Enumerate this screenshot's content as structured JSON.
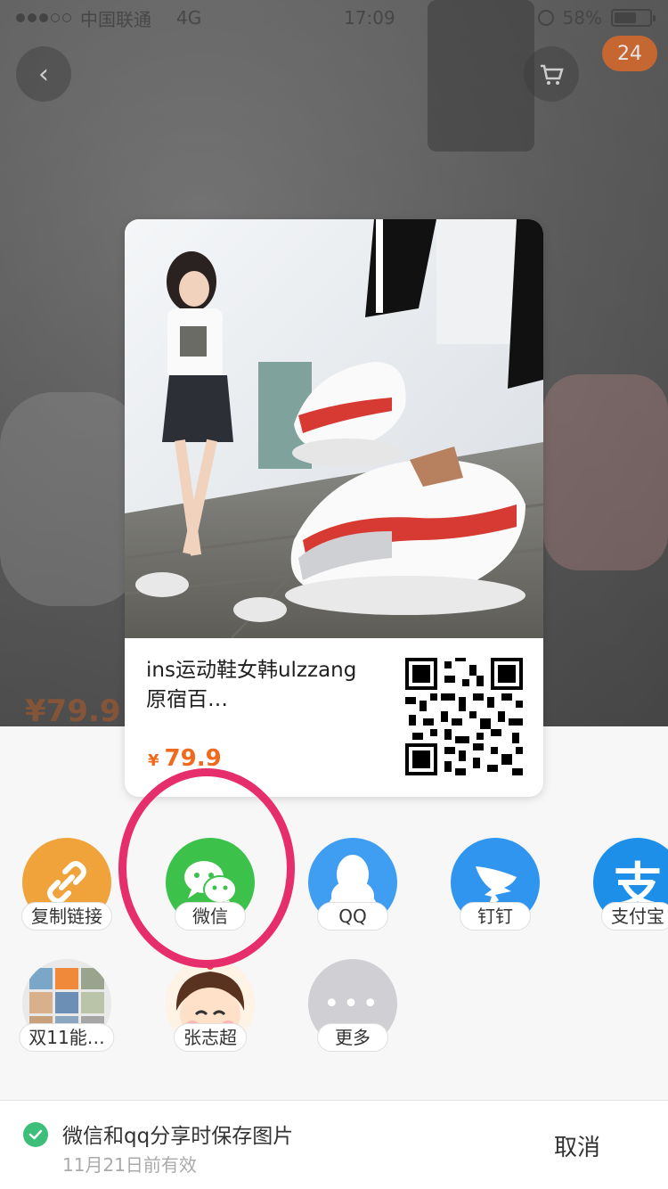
{
  "status_bar": {
    "carrier": "中国联通",
    "network": "4G",
    "time": "17:09",
    "battery": "58%"
  },
  "background_page": {
    "cart_badge": "24",
    "price": "¥79.9"
  },
  "share_card": {
    "title": "ins运动鞋女韩ulzzang原宿百…",
    "price_symbol": "¥",
    "price": "79.9"
  },
  "share_row_1": [
    {
      "label": "复制链接",
      "icon": "link-icon",
      "color": "#f0a33a"
    },
    {
      "label": "微信",
      "icon": "wechat-icon",
      "color": "#3cc24a"
    },
    {
      "label": "QQ",
      "icon": "qq-penguin-icon",
      "color": "#3f9ef2"
    },
    {
      "label": "钉钉",
      "icon": "dingtalk-icon",
      "color": "#2f95ef"
    },
    {
      "label": "支付宝",
      "icon": "alipay-icon",
      "color": "#1e8fe8"
    }
  ],
  "share_row_2": [
    {
      "label": "双11能…",
      "icon": "group-avatar-icon"
    },
    {
      "label": "张志超",
      "icon": "user-avatar-icon"
    },
    {
      "label": "更多",
      "icon": "more-dots-icon"
    }
  ],
  "bottom_bar": {
    "save_notice": "微信和qq分享时保存图片",
    "valid_until": "11月21日前有效",
    "cancel": "取消"
  },
  "colors": {
    "accent_price": "#f06a1e",
    "highlight_ring": "#e62e6c",
    "check_green": "#3dbf7a"
  }
}
